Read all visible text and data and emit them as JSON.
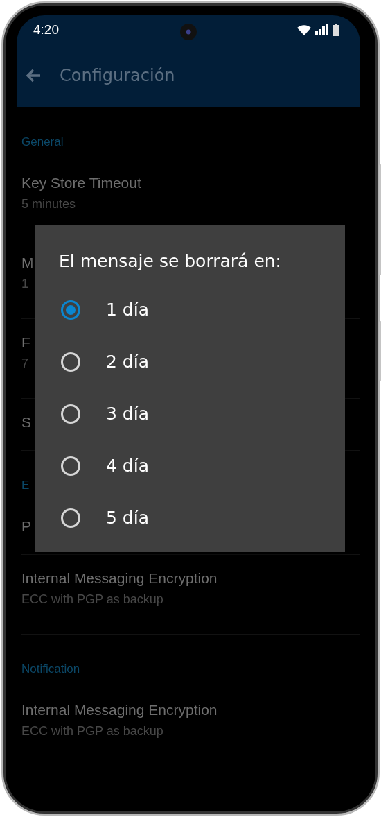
{
  "status_bar": {
    "time": "4:20"
  },
  "app_bar": {
    "title": "Configuración"
  },
  "settings": [
    {
      "kind": "header",
      "title": "General"
    },
    {
      "kind": "item",
      "title": "Key Store Timeout",
      "subtitle": "5 minutes"
    },
    {
      "kind": "item",
      "title": "M",
      "subtitle": "1"
    },
    {
      "kind": "item",
      "title": "F",
      "subtitle": "7"
    },
    {
      "kind": "item",
      "title": "S"
    },
    {
      "kind": "header",
      "title": "E"
    },
    {
      "kind": "item",
      "title": "P"
    },
    {
      "kind": "item",
      "title": "Internal Messaging Encryption",
      "subtitle": "ECC with PGP as backup"
    },
    {
      "kind": "header",
      "title": "Notification"
    },
    {
      "kind": "item",
      "title": "Internal Messaging Encryption",
      "subtitle": "ECC with PGP as backup"
    }
  ],
  "dialog": {
    "title": "El mensaje se borrará en:",
    "options": [
      {
        "label": "1 día",
        "selected": true
      },
      {
        "label": "2 día",
        "selected": false
      },
      {
        "label": "3 día",
        "selected": false
      },
      {
        "label": "4 día",
        "selected": false
      },
      {
        "label": "5 día",
        "selected": false
      }
    ]
  }
}
